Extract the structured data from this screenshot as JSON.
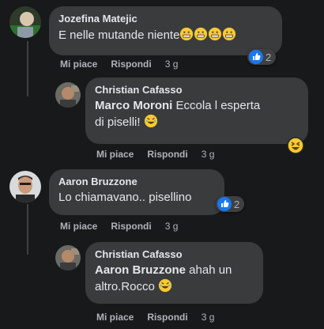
{
  "comments": [
    {
      "author": "Jozefina Matejic",
      "text": "E nelle mutande niente",
      "like": "Mi piace",
      "reply": "Rispondi",
      "time": "3 g",
      "reaction_count": "2",
      "reaction": "like"
    },
    {
      "author": "Christian Cafasso",
      "mention": "Marco Moroni",
      "text_line1": " Eccola l esperta",
      "text_line2": "di piselli! ",
      "like": "Mi piace",
      "reply": "Rispondi",
      "time": "3 g",
      "reaction": "haha"
    },
    {
      "author": "Aaron Bruzzone",
      "text": "Lo chiamavano.. pisellino",
      "like": "Mi piace",
      "reply": "Rispondi",
      "time": "3 g",
      "reaction_count": "2",
      "reaction": "like"
    },
    {
      "author": "Christian Cafasso",
      "mention": "Aaron Bruzzone",
      "text_line1": " ahah un",
      "text_line2": "altro.Rocco ",
      "like": "Mi piace",
      "reply": "Rispondi",
      "time": "3 g"
    }
  ],
  "colors": {
    "background": "#18191a",
    "bubble": "#3a3b3c",
    "like_blue": "#1877f2",
    "emoji_yellow": "#f7c934"
  }
}
